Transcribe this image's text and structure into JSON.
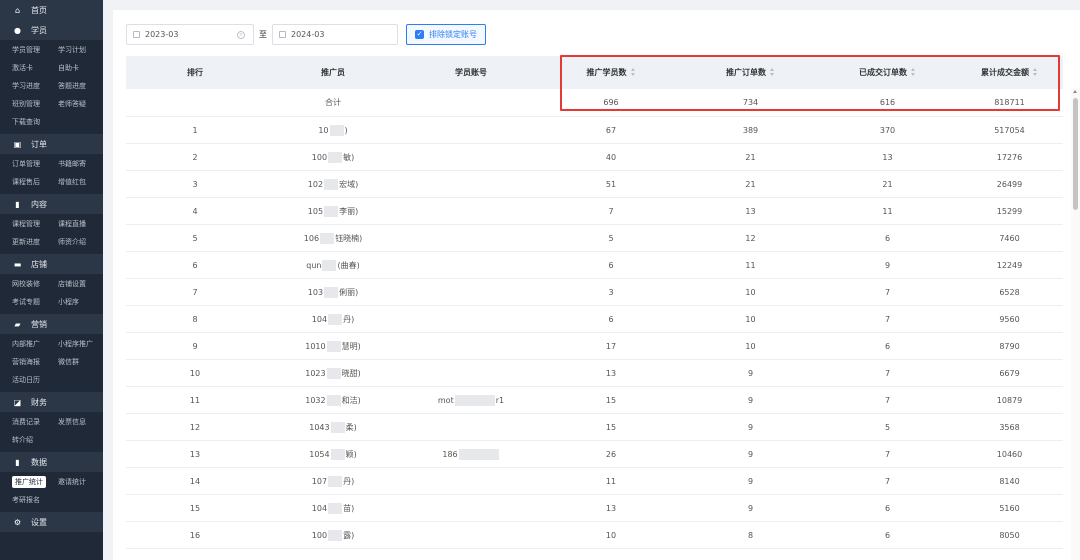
{
  "sidebar": {
    "sections": [
      {
        "title": "首页",
        "icon": "home-icon",
        "items": []
      },
      {
        "title": "学员",
        "icon": "user-icon",
        "items": [
          "学员管理",
          "学习计划",
          "激活卡",
          "自助卡",
          "学习进度",
          "答题进度",
          "班别管理",
          "老师答疑",
          "下载查询"
        ]
      },
      {
        "title": "订单",
        "icon": "clipboard-icon",
        "items": [
          "订单管理",
          "书籍邮寄",
          "课程售后",
          "增值红包"
        ]
      },
      {
        "title": "内容",
        "icon": "chart-bars-icon",
        "items": [
          "课程管理",
          "课程直播",
          "更新进度",
          "师资介绍"
        ]
      },
      {
        "title": "店铺",
        "icon": "store-icon",
        "items": [
          "网校装修",
          "店铺设置",
          "考试专题",
          "小程序"
        ]
      },
      {
        "title": "营销",
        "icon": "ticket-icon",
        "items": [
          "内部推广",
          "小程序推广",
          "营销海报",
          "微信群",
          "活动日历"
        ]
      },
      {
        "title": "财务",
        "icon": "wallet-icon",
        "items": [
          "消费记录",
          "发票信息",
          "转介绍"
        ]
      },
      {
        "title": "数据",
        "icon": "data-bars-icon",
        "items": [
          "推广统计",
          "邀请统计",
          "考研报名"
        ],
        "active": "推广统计"
      },
      {
        "title": "设置",
        "icon": "settings-icon",
        "items": []
      }
    ]
  },
  "filters": {
    "start_date": "2023-03",
    "separator": "至",
    "end_date": "2024-03",
    "exclude_label": "排除锁定账号",
    "exclude_checked": true
  },
  "table": {
    "headers": [
      "排行",
      "推广员",
      "学员账号",
      "推广学员数",
      "推广订单数",
      "已成交订单数",
      "累计成交金额"
    ],
    "total": {
      "label": "合计",
      "students": "696",
      "orders": "734",
      "completed": "616",
      "amount": "818711"
    },
    "rows": [
      {
        "rank": "1",
        "promoter": [
          "10",
          ")"
        ],
        "account": "",
        "students": "67",
        "orders": "389",
        "completed": "370",
        "amount": "517054"
      },
      {
        "rank": "2",
        "promoter": [
          "100",
          "敏)"
        ],
        "account": "",
        "students": "40",
        "orders": "21",
        "completed": "13",
        "amount": "17276"
      },
      {
        "rank": "3",
        "promoter": [
          "102",
          "宏域)"
        ],
        "account": "",
        "students": "51",
        "orders": "21",
        "completed": "21",
        "amount": "26499"
      },
      {
        "rank": "4",
        "promoter": [
          "105",
          "李丽)"
        ],
        "account": "",
        "students": "7",
        "orders": "13",
        "completed": "11",
        "amount": "15299"
      },
      {
        "rank": "5",
        "promoter": [
          "106",
          "钰晓楠)"
        ],
        "account": "",
        "students": "5",
        "orders": "12",
        "completed": "6",
        "amount": "7460"
      },
      {
        "rank": "6",
        "promoter": [
          "qun",
          "(曲春)"
        ],
        "account": "",
        "students": "6",
        "orders": "11",
        "completed": "9",
        "amount": "12249"
      },
      {
        "rank": "7",
        "promoter": [
          "103",
          "俐丽)"
        ],
        "account": "",
        "students": "3",
        "orders": "10",
        "completed": "7",
        "amount": "6528"
      },
      {
        "rank": "8",
        "promoter": [
          "104",
          "丹)"
        ],
        "account": "",
        "students": "6",
        "orders": "10",
        "completed": "7",
        "amount": "9560"
      },
      {
        "rank": "9",
        "promoter": [
          "1010",
          "慧明)"
        ],
        "account": "",
        "students": "17",
        "orders": "10",
        "completed": "6",
        "amount": "8790"
      },
      {
        "rank": "10",
        "promoter": [
          "1023",
          "晓甜)"
        ],
        "account": "",
        "students": "13",
        "orders": "9",
        "completed": "7",
        "amount": "6679"
      },
      {
        "rank": "11",
        "promoter": [
          "1032",
          "和洁)"
        ],
        "account": [
          "mot",
          "r1"
        ],
        "students": "15",
        "orders": "9",
        "completed": "7",
        "amount": "10879"
      },
      {
        "rank": "12",
        "promoter": [
          "1043",
          "柔)"
        ],
        "account": "",
        "students": "15",
        "orders": "9",
        "completed": "5",
        "amount": "3568"
      },
      {
        "rank": "13",
        "promoter": [
          "1054",
          "颖)"
        ],
        "account": [
          "186",
          ""
        ],
        "students": "26",
        "orders": "9",
        "completed": "7",
        "amount": "10460"
      },
      {
        "rank": "14",
        "promoter": [
          "107",
          "丹)"
        ],
        "account": "",
        "students": "11",
        "orders": "9",
        "completed": "7",
        "amount": "8140"
      },
      {
        "rank": "15",
        "promoter": [
          "104",
          "苗)"
        ],
        "account": "",
        "students": "13",
        "orders": "9",
        "completed": "6",
        "amount": "5160"
      },
      {
        "rank": "16",
        "promoter": [
          "100",
          "露)"
        ],
        "account": "",
        "students": "10",
        "orders": "8",
        "completed": "6",
        "amount": "8050"
      }
    ]
  },
  "colors": {
    "sidebar_bg": "#1f2937",
    "accent": "#2d7df5",
    "highlight": "#e53935"
  }
}
